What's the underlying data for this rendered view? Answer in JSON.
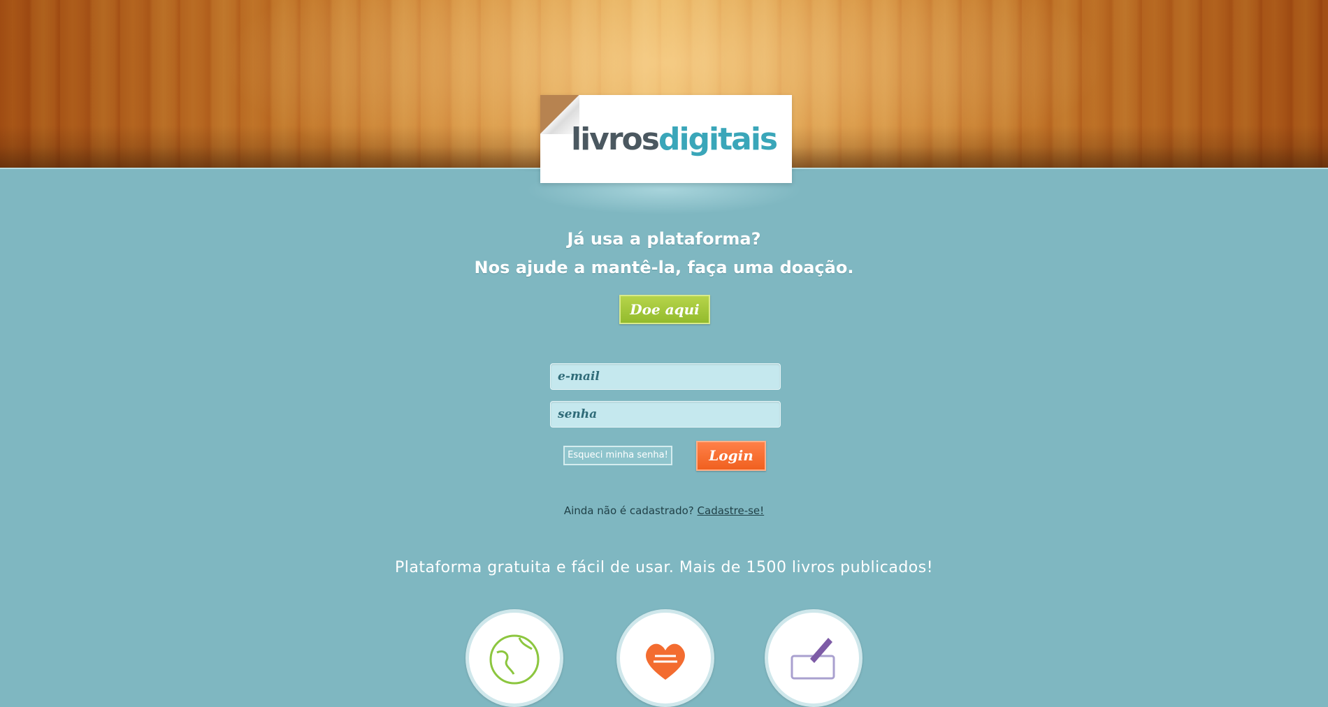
{
  "brand": {
    "logo_part1": "livros",
    "logo_part2": "digitais",
    "colors": {
      "logo_dark": "#4b5860",
      "logo_accent": "#3aa6b9",
      "background": "#7fb7c1",
      "donate_green": "#a3c83a",
      "login_orange": "#f7692b"
    }
  },
  "donation": {
    "headline_line1": "Já usa a plataforma?",
    "headline_line2": "Nos ajude a mantê-la, faça uma doação.",
    "button_label": "Doe aqui"
  },
  "login_form": {
    "email_placeholder": "e-mail",
    "password_placeholder": "senha",
    "forgot_label": "Esqueci minha senha!",
    "login_label": "Login"
  },
  "register": {
    "prompt": "Ainda não é cadastrado?",
    "link_label": "Cadastre-se!"
  },
  "tagline": "Plataforma gratuita e fácil de usar. Mais de 1500 livros publicados!",
  "features": [
    {
      "icon": "globe-icon"
    },
    {
      "icon": "heart-icon"
    },
    {
      "icon": "pencil-icon"
    }
  ]
}
